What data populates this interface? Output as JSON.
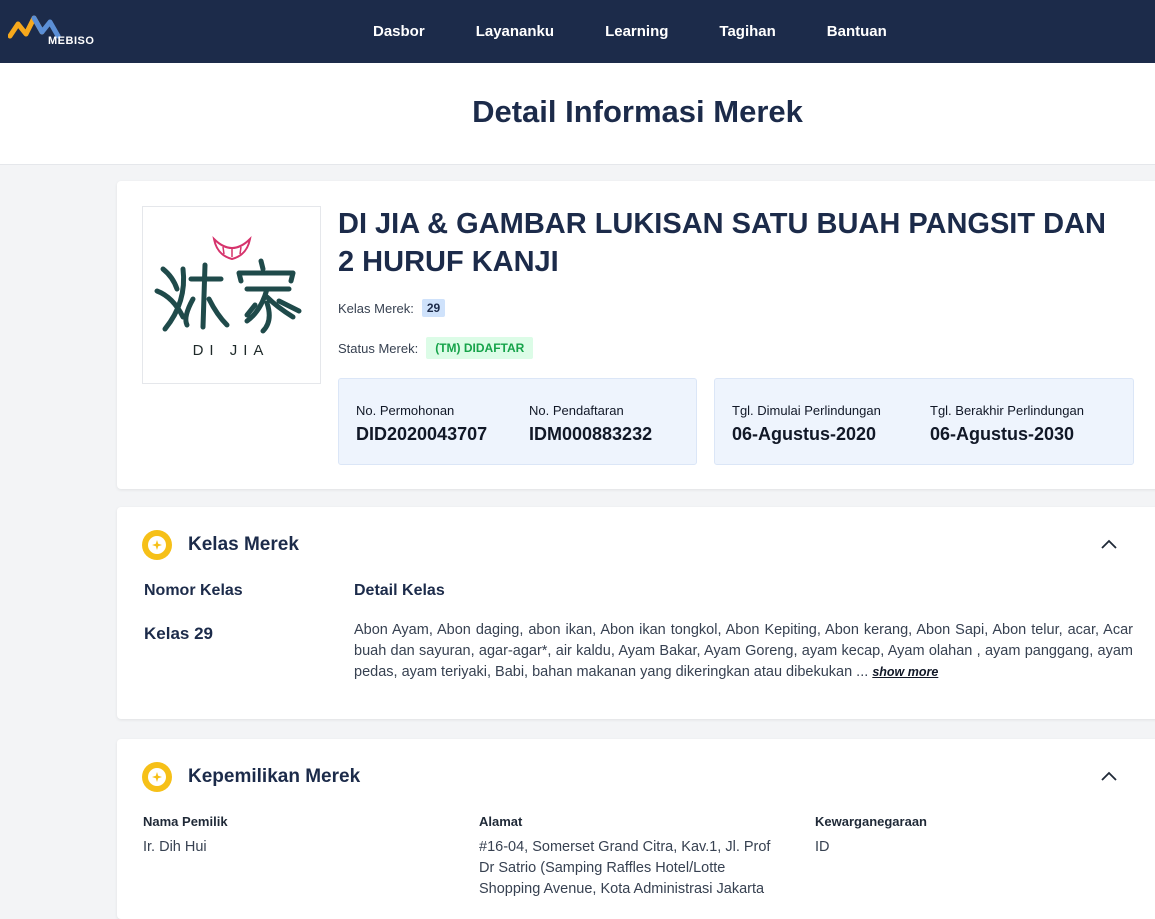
{
  "nav": {
    "logo_text": "MEBISO",
    "items": [
      "Dasbor",
      "Layananku",
      "Learning",
      "Tagihan",
      "Bantuan"
    ]
  },
  "page": {
    "title": "Detail Informasi Merek"
  },
  "brand": {
    "name": "DI JIA & GAMBAR LUKISAN SATU BUAH PANGSIT DAN 2 HURUF KANJI",
    "logo_caption": "DI JIA",
    "class_label": "Kelas Merek:",
    "class_value": "29",
    "status_label": "Status Merek:",
    "status_value": "(TM) DIDAFTAR",
    "application_no_label": "No. Permohonan",
    "application_no": "DID2020043707",
    "registration_no_label": "No. Pendaftaran",
    "registration_no": "IDM000883232",
    "protection_start_label": "Tgl. Dimulai Perlindungan",
    "protection_start": "06-Agustus-2020",
    "protection_end_label": "Tgl. Berakhir Perlindungan",
    "protection_end": "06-Agustus-2030"
  },
  "class_section": {
    "title": "Kelas Merek",
    "col_number": "Nomor Kelas",
    "col_detail": "Detail Kelas",
    "class_number": "Kelas 29",
    "class_detail": "Abon Ayam, Abon daging, abon ikan, Abon ikan tongkol, Abon Kepiting, Abon kerang, Abon Sapi, Abon telur, acar, Acar buah dan sayuran, agar-agar*, air kaldu, Ayam Bakar, Ayam Goreng, ayam kecap, Ayam olahan , ayam panggang, ayam pedas, ayam teriyaki, Babi, bahan makanan yang dikeringkan atau dibekukan ...",
    "show_more": "show more"
  },
  "ownership_section": {
    "title": "Kepemilikan Merek",
    "owner_label": "Nama Pemilik",
    "owner_value": "Ir. Dih Hui",
    "address_label": "Alamat",
    "address_value": "#16-04, Somerset Grand Citra, Kav.1, Jl. Prof Dr Satrio (Samping Raffles Hotel/Lotte Shopping Avenue, Kota Administrasi Jakarta",
    "citizenship_label": "Kewarganegaraan",
    "citizenship_value": "ID"
  },
  "colors": {
    "navbar": "#1c2b4a",
    "accent_gold": "#f6c018",
    "status_green": "#16a34a",
    "info_box_bg": "#eef4fd"
  }
}
